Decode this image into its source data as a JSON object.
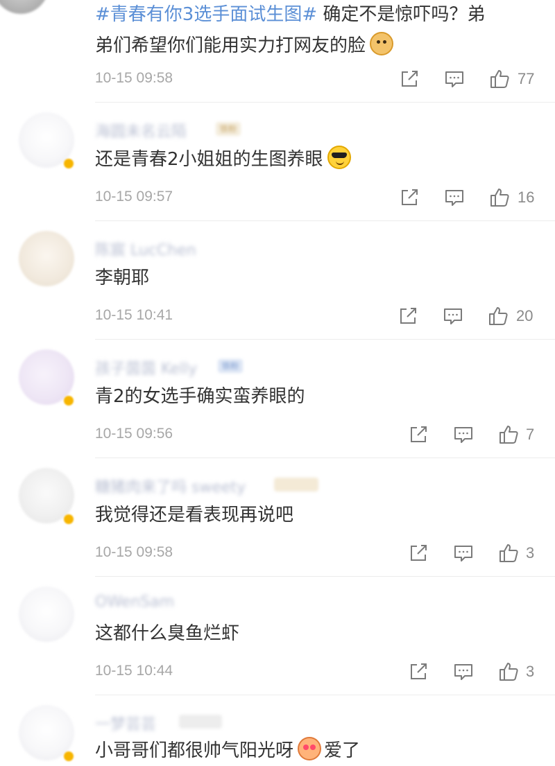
{
  "comments": [
    {
      "text_prefix": "#青春有你3选手面试生图#",
      "text_line1": " 确定不是惊吓吗？弟",
      "text_line2": "弟们希望你们能用实力打网友的脸",
      "emoji": "doge-emoji",
      "time": "10-15 09:58",
      "likes": "77"
    },
    {
      "username": "海圆未名云陌",
      "fan_badge": "铁粉",
      "text": "还是青春2小姐姐的生图养眼",
      "emoji": "cool-emoji",
      "time": "10-15 09:57",
      "likes": "16"
    },
    {
      "username": "陈宸 LucChen",
      "text": "李朝耶",
      "time": "10-15 10:41",
      "likes": "20"
    },
    {
      "username": "孩子茵茵 Kelly",
      "fan_badge": "铁粉",
      "text": "青2的女选手确实蛮养眼的",
      "time": "10-15 09:56",
      "likes": "7"
    },
    {
      "username": "糖猪肉来了吗 sweety",
      "text": "我觉得还是看表现再说吧",
      "time": "10-15 09:58",
      "likes": "3"
    },
    {
      "username": "OWenSam",
      "text": "这都什么臭鱼烂虾",
      "time": "10-15 10:44",
      "likes": "3"
    },
    {
      "username": "一梦芸芸",
      "text_before": "小哥哥们都很帅气阳光呀",
      "text_after": "爱了",
      "emoji": "love-emoji"
    }
  ],
  "colors": {
    "hashtag": "#5b8fd6",
    "text": "#333333",
    "meta": "#a7a7a7",
    "vip_badge": "#f7b500"
  }
}
